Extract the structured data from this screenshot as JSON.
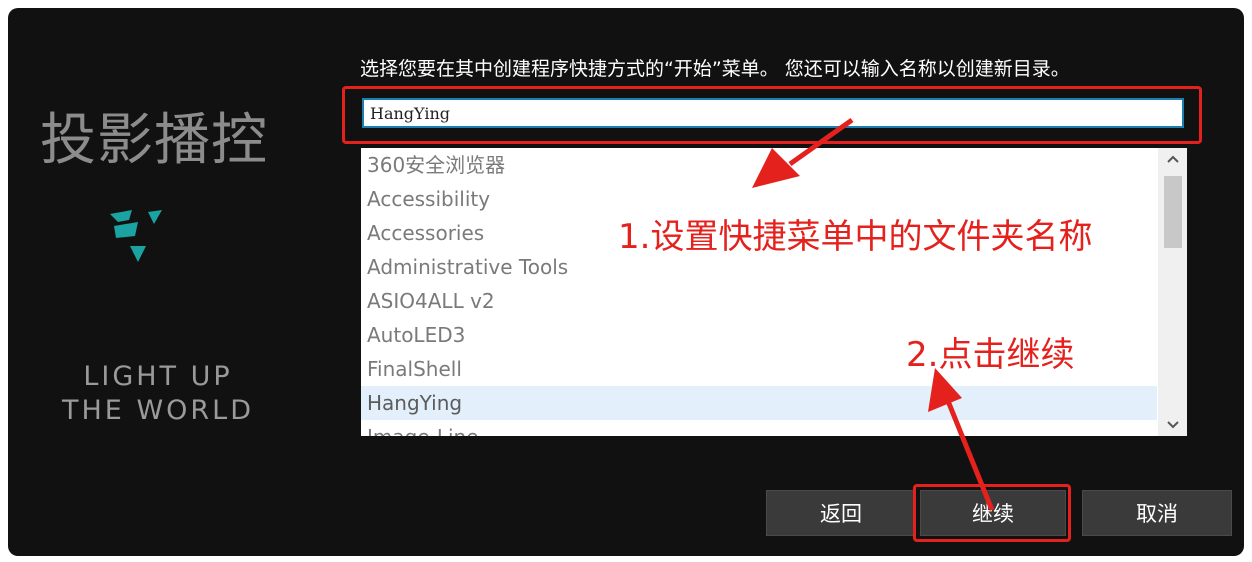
{
  "brand": {
    "title": "投影播控",
    "slogan_line1": "LIGHT UP",
    "slogan_line2": "THE WORLD",
    "logo_color": "#1aa3a0"
  },
  "instruction": "选择您要在其中创建程序快捷方式的“开始”菜单。 您还可以输入名称以创建新目录。",
  "folder_input": {
    "value": "HangYing"
  },
  "folder_list": {
    "items": [
      "360安全浏览器",
      "Accessibility",
      "Accessories",
      "Administrative Tools",
      "ASIO4ALL v2",
      "AutoLED3",
      "FinalShell",
      "HangYing",
      "Image-Line"
    ],
    "selected": "HangYing"
  },
  "annotations": {
    "step1": "1.设置快捷菜单中的文件夹名称",
    "step2": "2.点击继续",
    "color": "#e4211d"
  },
  "buttons": {
    "back": "返回",
    "next": "继续",
    "cancel": "取消"
  }
}
